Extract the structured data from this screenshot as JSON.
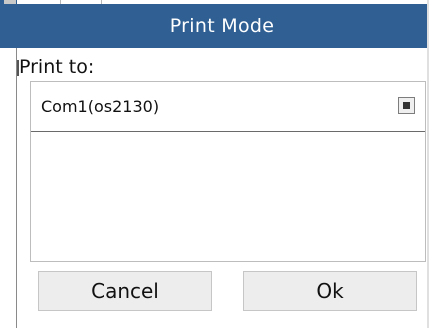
{
  "dialog": {
    "title": "Print Mode",
    "print_to_label": "Print to:",
    "printers": [
      {
        "label": "Com1(os2130)",
        "selected": true
      }
    ],
    "buttons": {
      "cancel_label": "Cancel",
      "ok_label": "Ok"
    }
  },
  "colors": {
    "titlebar": "#2f5f93",
    "button_bg": "#ededed"
  }
}
